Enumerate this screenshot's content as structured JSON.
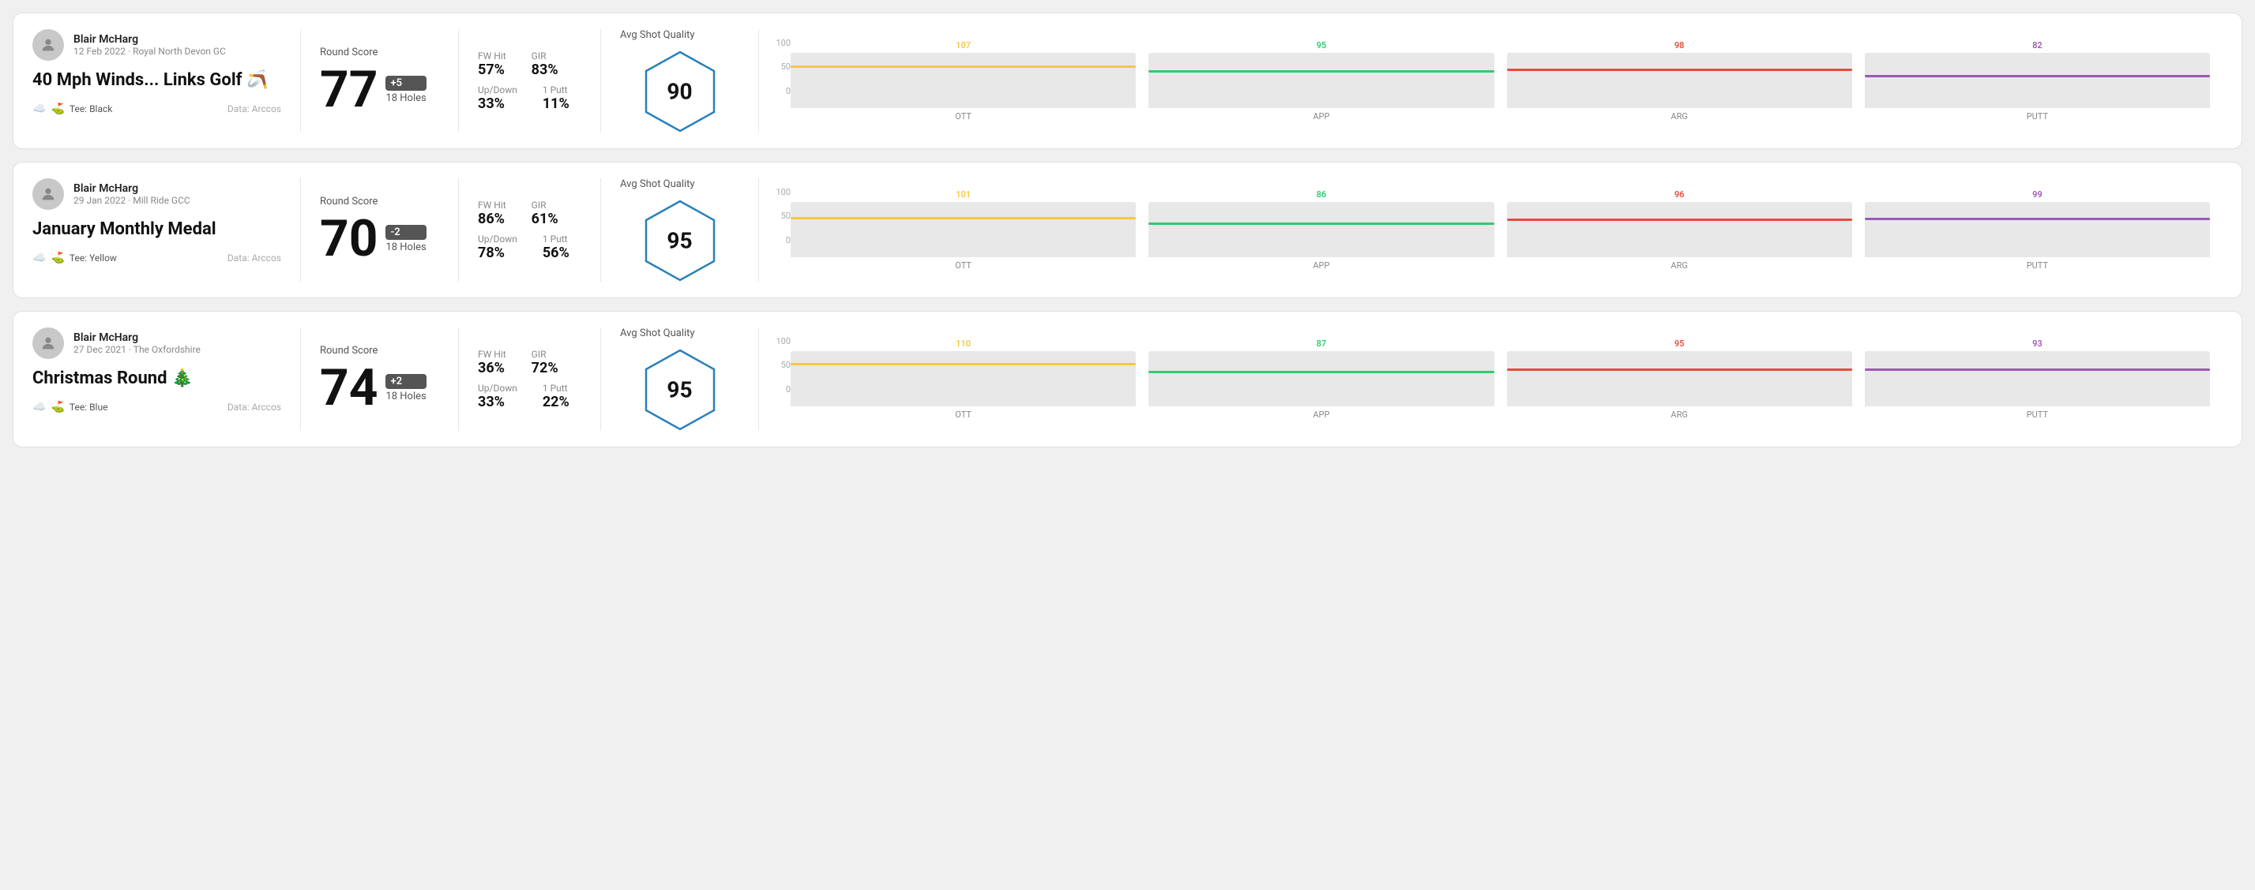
{
  "rounds": [
    {
      "id": "round1",
      "user": {
        "name": "Blair McHarg",
        "meta": "12 Feb 2022 · Royal North Devon GC"
      },
      "title": "40 Mph Winds... Links Golf 🪃",
      "tee": "Black",
      "data_source": "Data: Arccos",
      "score": {
        "label": "Round Score",
        "number": "77",
        "badge": "+5",
        "holes": "18 Holes"
      },
      "stats": {
        "fw_hit_label": "FW Hit",
        "fw_hit_value": "57%",
        "gir_label": "GIR",
        "gir_value": "83%",
        "updown_label": "Up/Down",
        "updown_value": "33%",
        "oneputt_label": "1 Putt",
        "oneputt_value": "11%"
      },
      "quality": {
        "label": "Avg Shot Quality",
        "score": "90"
      },
      "chart": {
        "bars": [
          {
            "label": "OTT",
            "value": 107,
            "color": "#f5c842",
            "height_pct": 72
          },
          {
            "label": "APP",
            "value": 95,
            "color": "#2ecc71",
            "height_pct": 64
          },
          {
            "label": "ARG",
            "value": 98,
            "color": "#e74c3c",
            "height_pct": 66
          },
          {
            "label": "PUTT",
            "value": 82,
            "color": "#9b59b6",
            "height_pct": 55
          }
        ]
      }
    },
    {
      "id": "round2",
      "user": {
        "name": "Blair McHarg",
        "meta": "29 Jan 2022 · Mill Ride GCC"
      },
      "title": "January Monthly Medal",
      "tee": "Yellow",
      "data_source": "Data: Arccos",
      "score": {
        "label": "Round Score",
        "number": "70",
        "badge": "-2",
        "holes": "18 Holes"
      },
      "stats": {
        "fw_hit_label": "FW Hit",
        "fw_hit_value": "86%",
        "gir_label": "GIR",
        "gir_value": "61%",
        "updown_label": "Up/Down",
        "updown_value": "78%",
        "oneputt_label": "1 Putt",
        "oneputt_value": "56%"
      },
      "quality": {
        "label": "Avg Shot Quality",
        "score": "95"
      },
      "chart": {
        "bars": [
          {
            "label": "OTT",
            "value": 101,
            "color": "#f5c842",
            "height_pct": 68
          },
          {
            "label": "APP",
            "value": 86,
            "color": "#2ecc71",
            "height_pct": 58
          },
          {
            "label": "ARG",
            "value": 96,
            "color": "#e74c3c",
            "height_pct": 65
          },
          {
            "label": "PUTT",
            "value": 99,
            "color": "#9b59b6",
            "height_pct": 67
          }
        ]
      }
    },
    {
      "id": "round3",
      "user": {
        "name": "Blair McHarg",
        "meta": "27 Dec 2021 · The Oxfordshire"
      },
      "title": "Christmas Round 🎄",
      "tee": "Blue",
      "data_source": "Data: Arccos",
      "score": {
        "label": "Round Score",
        "number": "74",
        "badge": "+2",
        "holes": "18 Holes"
      },
      "stats": {
        "fw_hit_label": "FW Hit",
        "fw_hit_value": "36%",
        "gir_label": "GIR",
        "gir_value": "72%",
        "updown_label": "Up/Down",
        "updown_value": "33%",
        "oneputt_label": "1 Putt",
        "oneputt_value": "22%"
      },
      "quality": {
        "label": "Avg Shot Quality",
        "score": "95"
      },
      "chart": {
        "bars": [
          {
            "label": "OTT",
            "value": 110,
            "color": "#f5c842",
            "height_pct": 74
          },
          {
            "label": "APP",
            "value": 87,
            "color": "#2ecc71",
            "height_pct": 59
          },
          {
            "label": "ARG",
            "value": 95,
            "color": "#e74c3c",
            "height_pct": 64
          },
          {
            "label": "PUTT",
            "value": 93,
            "color": "#9b59b6",
            "height_pct": 63
          }
        ]
      }
    }
  ]
}
